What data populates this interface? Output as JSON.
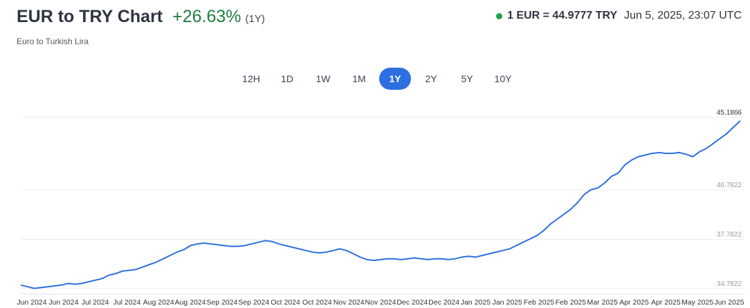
{
  "header": {
    "title": "EUR to TRY Chart",
    "change": "+26.63%",
    "period": "(1Y)",
    "subtitle": "Euro to Turkish Lira",
    "rate": "1 EUR = 44.9777 TRY",
    "timestamp": "Jun 5, 2025, 23:07 UTC",
    "status_color": "#21a045"
  },
  "ranges": [
    "12H",
    "1D",
    "1W",
    "1M",
    "1Y",
    "2Y",
    "5Y",
    "10Y"
  ],
  "active_range": "1Y",
  "chart_data": {
    "type": "line",
    "title": "",
    "xlabel": "",
    "ylabel": "",
    "line_color": "#2d6fe0",
    "x_tick_labels": [
      "Jun 2024",
      "Jun 2024",
      "Jul 2024",
      "Jul 2024",
      "Aug 2024",
      "Aug 2024",
      "Sep 2024",
      "Sep 2024",
      "Oct 2024",
      "Oct 2024",
      "Nov 2024",
      "Nov 2024",
      "Dec 2024",
      "Dec 2024",
      "Jan 2025",
      "Jan 2025",
      "Feb 2025",
      "Feb 2025",
      "Mar 2025",
      "Apr 2025",
      "Apr 2025",
      "May 2025",
      "Jun 2025"
    ],
    "y_tick_labels": [
      "34.7822",
      "37.7822",
      "40.7822",
      "45.1866"
    ],
    "ylim": [
      34.7822,
      45.1866
    ],
    "grid": true,
    "series": [
      {
        "values": [
          35.0,
          34.9,
          34.8,
          34.85,
          34.9,
          34.95,
          35.0,
          35.1,
          35.05,
          35.1,
          35.2,
          35.3,
          35.4,
          35.6,
          35.7,
          35.85,
          35.9,
          35.95,
          36.1,
          36.25,
          36.4,
          36.6,
          36.8,
          37.0,
          37.15,
          37.4,
          37.5,
          37.55,
          37.5,
          37.45,
          37.4,
          37.35,
          37.35,
          37.4,
          37.5,
          37.6,
          37.7,
          37.65,
          37.5,
          37.4,
          37.3,
          37.2,
          37.1,
          37.0,
          36.95,
          37.0,
          37.1,
          37.2,
          37.1,
          36.9,
          36.7,
          36.55,
          36.5,
          36.55,
          36.6,
          36.6,
          36.55,
          36.6,
          36.65,
          36.6,
          36.55,
          36.6,
          36.6,
          36.55,
          36.6,
          36.7,
          36.75,
          36.7,
          36.8,
          36.9,
          37.0,
          37.1,
          37.2,
          37.4,
          37.6,
          37.8,
          38.0,
          38.3,
          38.7,
          39.0,
          39.3,
          39.6,
          40.0,
          40.5,
          40.8,
          40.9,
          41.2,
          41.6,
          41.8,
          42.3,
          42.6,
          42.8,
          42.9,
          43.0,
          43.05,
          43.0,
          43.0,
          43.05,
          42.95,
          42.8,
          43.1,
          43.3,
          43.6,
          43.9,
          44.2,
          44.6,
          44.98
        ]
      }
    ]
  }
}
